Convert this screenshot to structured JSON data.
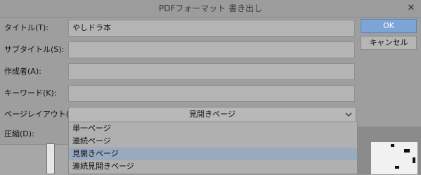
{
  "dialog": {
    "title": "PDFフォーマット 書き出し",
    "close_glyph": "✕"
  },
  "fields": {
    "title": {
      "label": "タイトル(T):",
      "value": "やしドラ本"
    },
    "subtitle": {
      "label": "サブタイトル(S):",
      "value": ""
    },
    "author": {
      "label": "作成者(A):",
      "value": ""
    },
    "keywords": {
      "label": "キーワード(K):",
      "value": ""
    }
  },
  "page_layout": {
    "label": "ページレイアウト(P):",
    "selected": "見開きページ",
    "options": [
      "単一ページ",
      "連続ページ",
      "見開きページ",
      "連続見開きページ"
    ],
    "selected_index": 2
  },
  "compression": {
    "label": "圧縮(D):"
  },
  "buttons": {
    "ok": "OK",
    "cancel": "キャンセル"
  },
  "colors": {
    "accent": "#7da4d6",
    "selection": "#98a9c0"
  },
  "icons": {
    "dropdown": "chevron-down-icon",
    "close": "close-icon"
  }
}
